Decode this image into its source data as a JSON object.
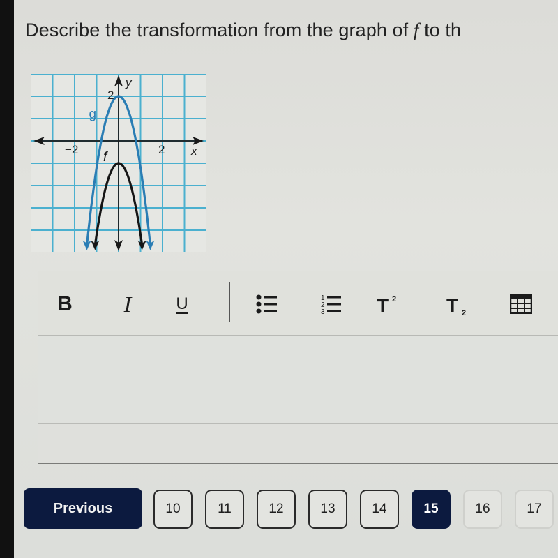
{
  "question": {
    "text_before": "Describe the transformation from the graph of ",
    "variable": "f",
    "text_after": " to th"
  },
  "graph": {
    "x_range": [
      -4,
      4
    ],
    "y_range": [
      -5,
      3
    ],
    "grid_step": 1,
    "axis_labels": {
      "x": "x",
      "y": "y"
    },
    "tick_labels": [
      {
        "axis": "x",
        "value": -2,
        "label": "−2"
      },
      {
        "axis": "x",
        "value": 2,
        "label": "2"
      },
      {
        "axis": "y",
        "value": 2,
        "label": "2"
      }
    ],
    "curves": [
      {
        "name": "g",
        "label": "g",
        "color": "#2a7db4",
        "vertex": [
          0,
          2
        ],
        "a": -3.2
      },
      {
        "name": "f",
        "label": "f",
        "color": "#151515",
        "vertex": [
          0,
          -1
        ],
        "a": -3.2
      }
    ],
    "grid_color": "#4bb0cf"
  },
  "toolbar": {
    "bold": "B",
    "italic": "I",
    "underline": "U",
    "buttons": [
      {
        "name": "bold-button",
        "icon": "bold-icon"
      },
      {
        "name": "italic-button",
        "icon": "italic-icon"
      },
      {
        "name": "underline-button",
        "icon": "underline-icon"
      },
      {
        "name": "bulleted-list-button",
        "icon": "bulleted-list-icon"
      },
      {
        "name": "numbered-list-button",
        "icon": "numbered-list-icon"
      },
      {
        "name": "superscript-button",
        "icon": "superscript-icon"
      },
      {
        "name": "subscript-button",
        "icon": "subscript-icon"
      },
      {
        "name": "table-button",
        "icon": "table-icon"
      }
    ]
  },
  "editor": {
    "value": ""
  },
  "pagination": {
    "previous_label": "Previous",
    "pages": [
      "10",
      "11",
      "12",
      "13",
      "14",
      "15",
      "16",
      "17"
    ],
    "current_page": "15",
    "accent_color": "#0c1a3f"
  }
}
